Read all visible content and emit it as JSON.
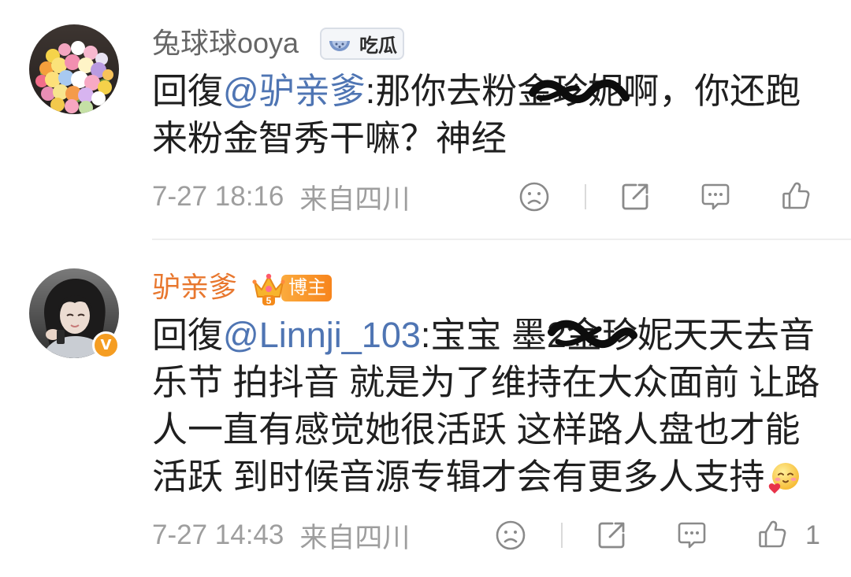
{
  "colors": {
    "text": "#1f1f1f",
    "mention": "#4f75b3",
    "username_default": "#666666",
    "username_vip": "#e8772e",
    "meta": "#9e9e9e",
    "icon": "#8a8a8a",
    "badge_orange": "#f7931e"
  },
  "action_icons": {
    "dislike": "sad-face-icon",
    "share": "share-icon",
    "comment": "comment-icon",
    "like": "thumbs-up-icon"
  },
  "comments": [
    {
      "username": "兔球球ooya",
      "avatar": "flower-bouquet-avatar",
      "badge": {
        "icon": "watermelon-icon",
        "label": "吃瓜"
      },
      "reply_prefix": "回復",
      "mention": "@驴亲爹",
      "text_lines": [
        ":那你去粉金珍妮啊，你还跑",
        "来粉金智秀干嘛？神经"
      ],
      "time": "7-27 18:16",
      "location": "来自四川"
    },
    {
      "username": "驴亲爹",
      "avatar": "girl-photo-avatar",
      "verified_mark": "V",
      "badge": {
        "icon": "crown-icon",
        "level": "5",
        "label": "博主"
      },
      "reply_prefix": "回復",
      "mention": "@Linnji_103",
      "text_lines": [
        ":宝宝 墨2金珍妮天天去音",
        "乐节 拍抖音 就是为了维持在大众面前 让路",
        "人一直有感觉她很活跃 这样路人盘也才能",
        "活跃 到时候音源专辑才会有更多人支持"
      ],
      "emoji": "heart-face-emoji",
      "time": "7-27 14:43",
      "location": "来自四川",
      "like_count": "1"
    }
  ]
}
